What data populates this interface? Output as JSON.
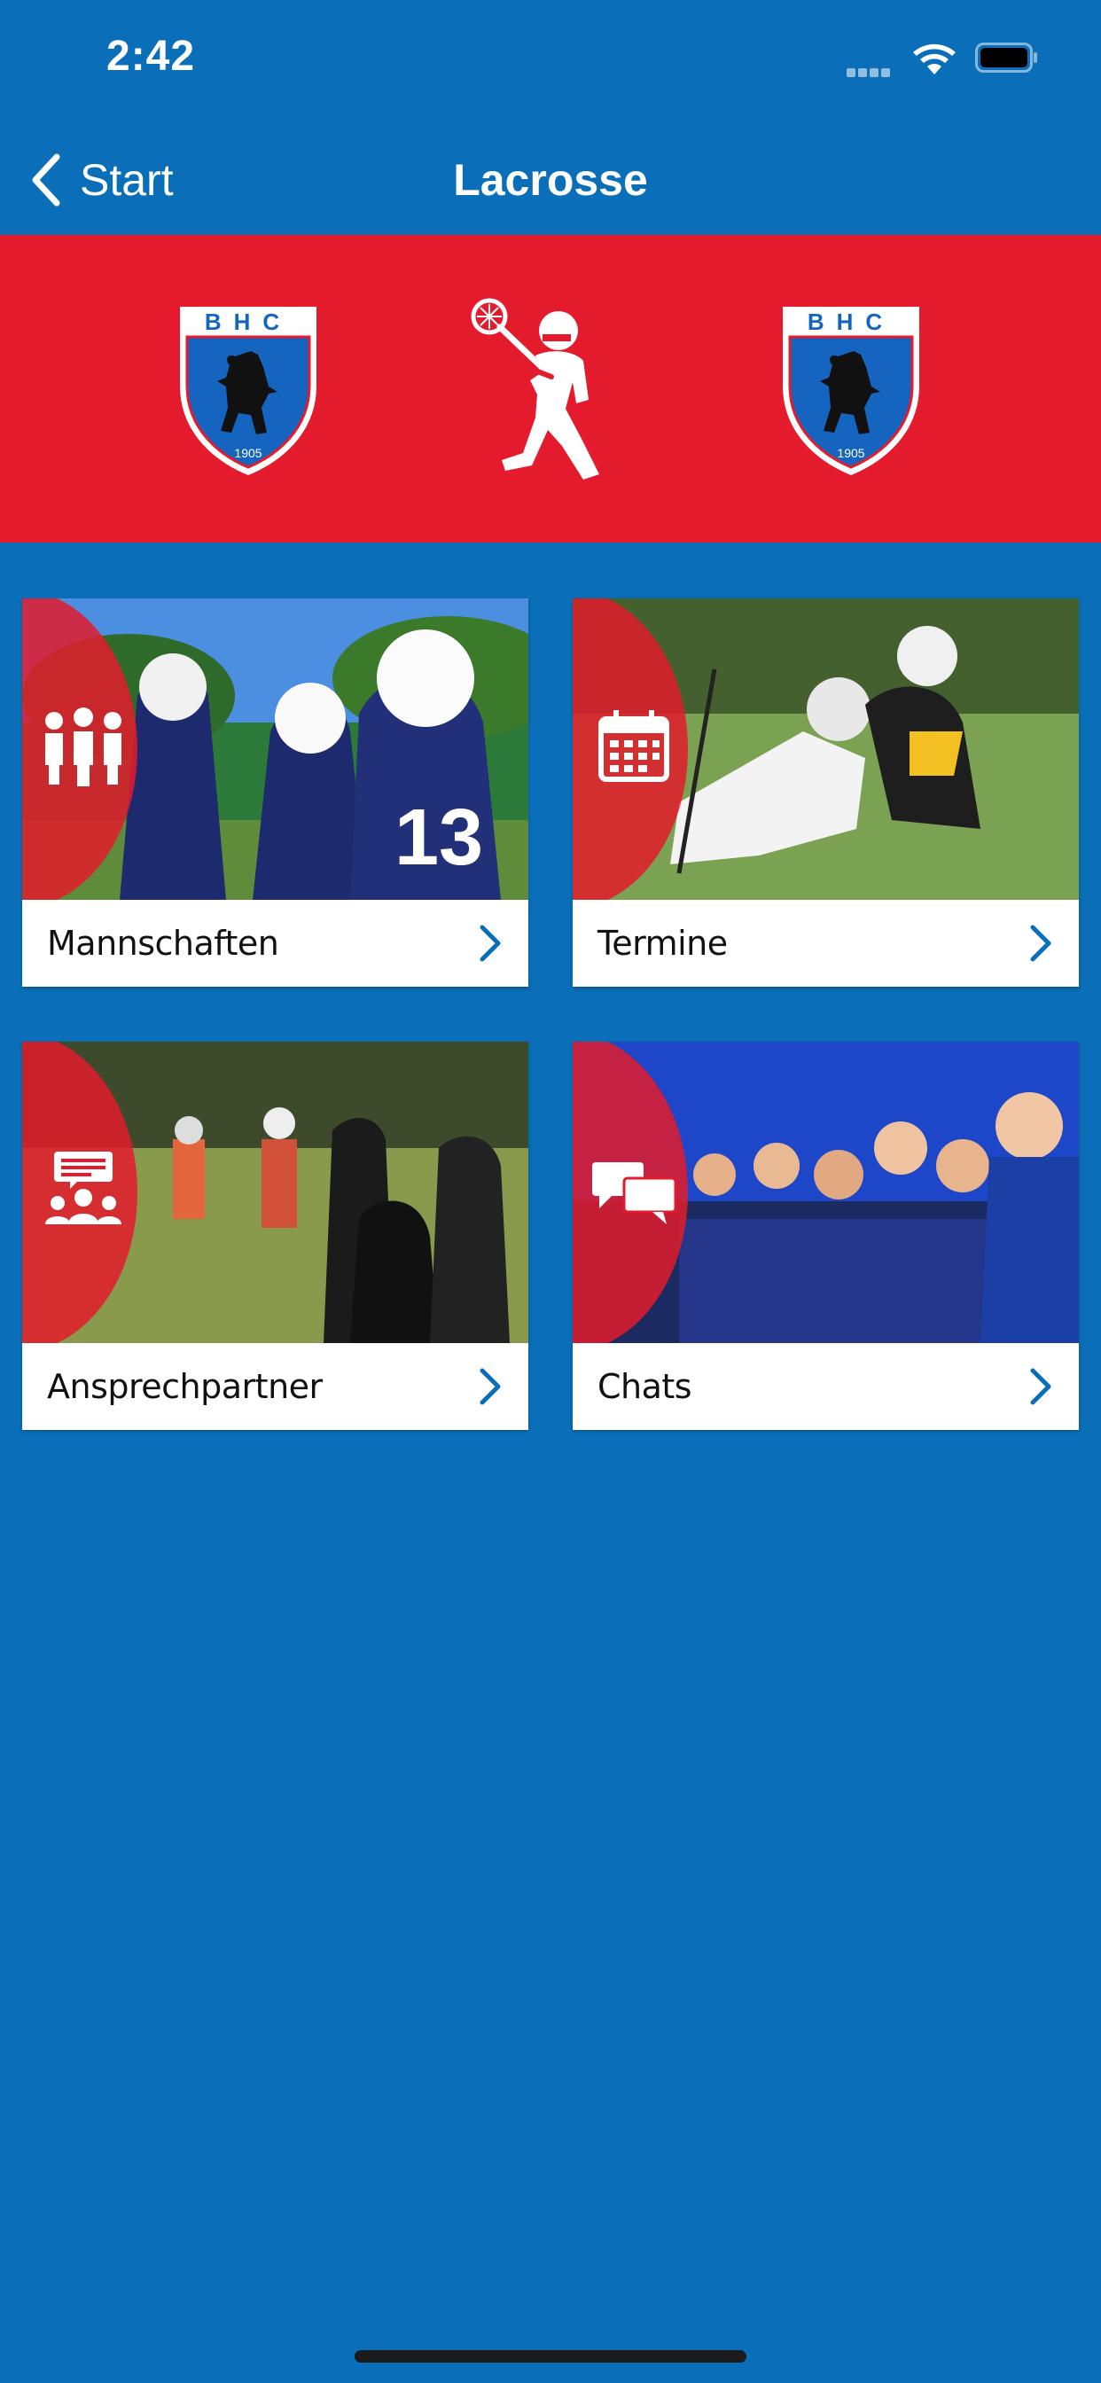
{
  "status_bar": {
    "time": "2:42"
  },
  "nav": {
    "back_label": "Start",
    "title": "Lacrosse"
  },
  "banner": {
    "crest_text": "BHC",
    "crest_year": "1905",
    "icons": [
      "bhc-crest-icon",
      "lacrosse-player-icon",
      "bhc-crest-icon"
    ]
  },
  "tiles": [
    {
      "label": "Mannschaften",
      "icon": "team-icon"
    },
    {
      "label": "Termine",
      "icon": "calendar-icon"
    },
    {
      "label": "Ansprechpartner",
      "icon": "contact-person-icon"
    },
    {
      "label": "Chats",
      "icon": "chat-bubbles-icon"
    }
  ],
  "colors": {
    "background": "#0a6fb8",
    "banner": "#e31b2c",
    "accent": "#0a6fb8"
  }
}
